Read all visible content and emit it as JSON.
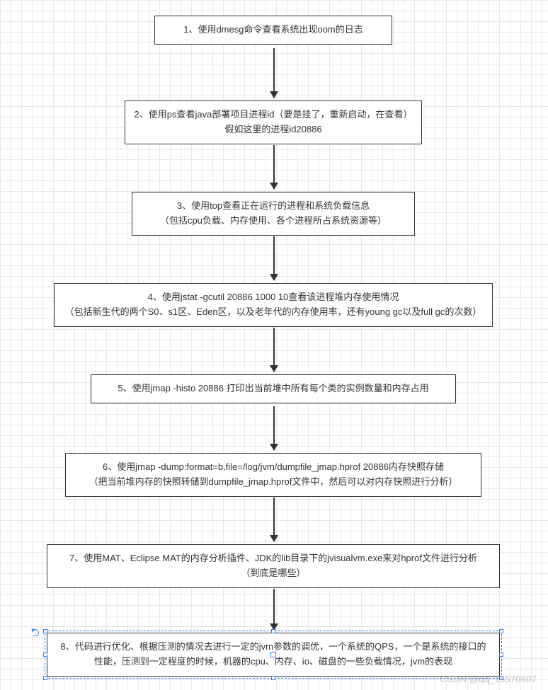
{
  "chart_data": {
    "type": "flowchart",
    "direction": "top-to-bottom",
    "nodes": [
      {
        "id": "n1",
        "line1": "1、使用dmesg命令查看系统出现oom的日志",
        "line2": ""
      },
      {
        "id": "n2",
        "line1": "2、使用ps查看java部署项目进程id（要是挂了，重新启动，在查看）",
        "line2": "假如这里的进程id20886"
      },
      {
        "id": "n3",
        "line1": "3、使用top查看正在运行的进程和系统负载信息",
        "line2": "（包括cpu负载、内存使用、各个进程所占系统资源等）"
      },
      {
        "id": "n4",
        "line1": "4、使用jstat -gcutil 20886 1000 10查看该进程堆内存使用情况",
        "line2": "（包括新生代的两个S0、s1区、Eden区，以及老年代的内存使用率，还有young gc以及full gc的次数）"
      },
      {
        "id": "n5",
        "line1": "5、使用jmap -histo 20886 打印出当前堆中所有每个类的实例数量和内存占用",
        "line2": ""
      },
      {
        "id": "n6",
        "line1": "6、使用jmap -dump:format=b,file=/log/jvm/dumpfile_jmap.hprof 20886内存快照存储",
        "line2": "（把当前堆内存的快照转储到dumpfile_jmap.hprof文件中，然后可以对内存快照进行分析）"
      },
      {
        "id": "n7",
        "line1": "7、使用MAT、Eclipse MAT的内存分析插件、JDK的lib目录下的jvisualvm.exe来对hprof文件进行分析",
        "line2": "（到底是哪些）"
      },
      {
        "id": "n8",
        "line1": "8、代码进行优化、根据压测的情况去进行一定的jvm参数的调优，一个系统的QPS，一个是系统的接口的",
        "line2": "性能，压测到一定程度的时候，机器的cpu、内存、io、磁盘的一些负载情况，jvm的表现",
        "selected": true
      }
    ],
    "edges": [
      {
        "from": "n1",
        "to": "n2"
      },
      {
        "from": "n2",
        "to": "n3"
      },
      {
        "from": "n3",
        "to": "n4"
      },
      {
        "from": "n4",
        "to": "n5"
      },
      {
        "from": "n5",
        "to": "n6"
      },
      {
        "from": "n6",
        "to": "n7"
      },
      {
        "from": "n7",
        "to": "n8"
      }
    ]
  },
  "watermark": "CSDN @qq_16570607"
}
